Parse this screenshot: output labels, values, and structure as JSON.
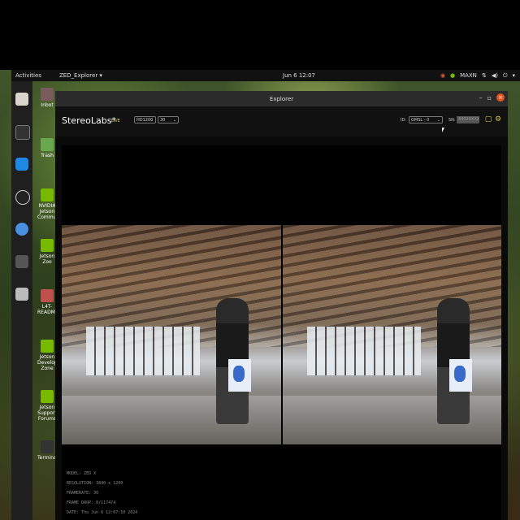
{
  "topbar": {
    "activities": "Activities",
    "app_menu": "ZED_Explorer ▾",
    "clock": "Jun 6  12:07",
    "status": "MAXN"
  },
  "desktop_icons": [
    "Inbot",
    "Trash",
    "NVIDIA Jetson Community",
    "Jetson Zoo",
    "L4T-README",
    "Jetson Developer Zone",
    "Jetson Support Forums",
    "Terminal"
  ],
  "window": {
    "title": "Explorer",
    "minimize": "–",
    "maximize": "▫",
    "close": "×"
  },
  "toolbar": {
    "brand": "StereoLabs*",
    "live": "LIVE",
    "resolution": "HD1200",
    "fps": "30",
    "id_label": "ID:",
    "camera": "GMSL - 0",
    "sn_label": "SN:",
    "serial": "44020XXX"
  },
  "metadata": {
    "model": "MODEL: ZED X",
    "resolution": "RESOLUTION: 3840 x 1200",
    "framerate": "FRAMERATE: 30",
    "frame_drop": "FRAME DROP: 0/117474",
    "date": "DATE: Thu Jun 6 12:07:10 2024"
  }
}
